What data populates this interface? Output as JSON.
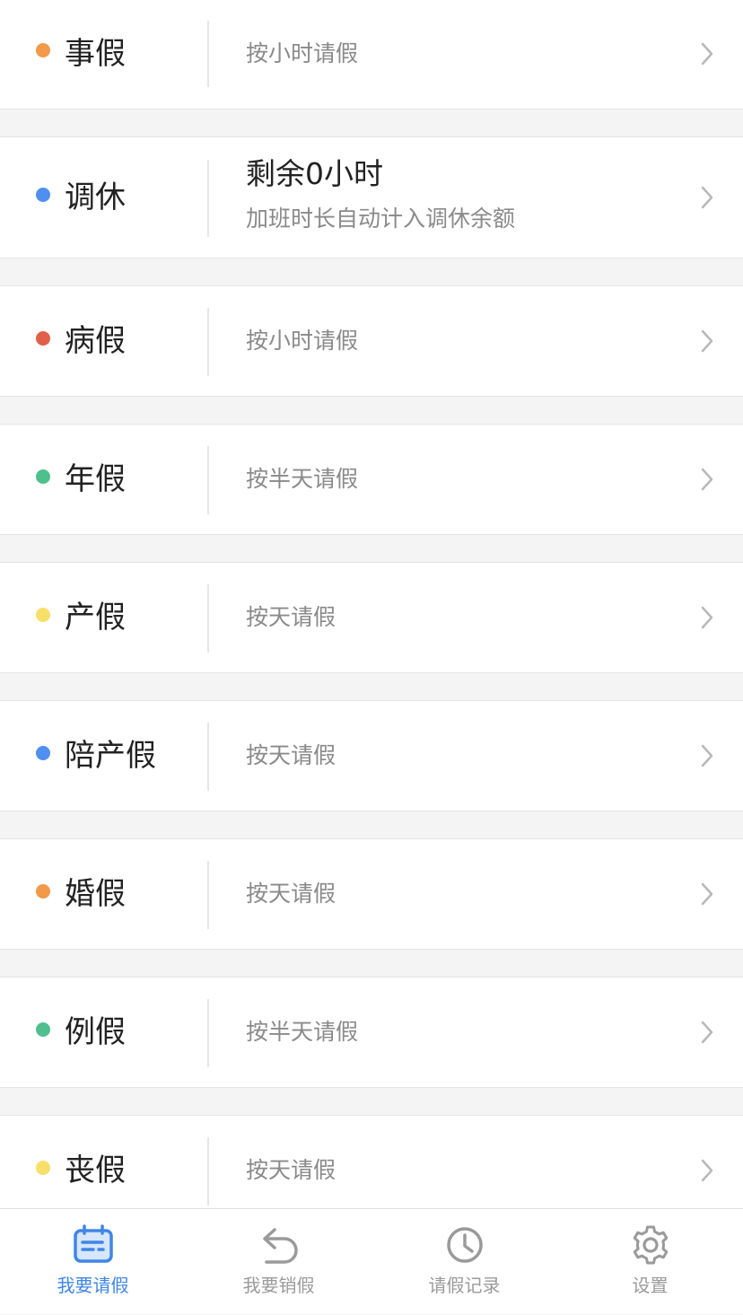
{
  "colors": {
    "orange": "#f2994a",
    "blue": "#4f8ff0",
    "red": "#e0604a",
    "green": "#4fc08d",
    "yellow": "#f7df6a",
    "active": "#3f86e6",
    "inactive": "#9a9a9a"
  },
  "leave_types": [
    {
      "name": "事假",
      "desc": "按小时请假",
      "dot": "orange"
    },
    {
      "name": "调休",
      "main": "剩余0小时",
      "desc": "加班时长自动计入调休余额",
      "dot": "blue"
    },
    {
      "name": "病假",
      "desc": "按小时请假",
      "dot": "red"
    },
    {
      "name": "年假",
      "desc": "按半天请假",
      "dot": "green"
    },
    {
      "name": "产假",
      "desc": "按天请假",
      "dot": "yellow"
    },
    {
      "name": "陪产假",
      "desc": "按天请假",
      "dot": "blue"
    },
    {
      "name": "婚假",
      "desc": "按天请假",
      "dot": "orange"
    },
    {
      "name": "例假",
      "desc": "按半天请假",
      "dot": "green"
    },
    {
      "name": "丧假",
      "desc": "按天请假",
      "dot": "yellow"
    }
  ],
  "tabbar": {
    "tabs": [
      {
        "label": "我要请假",
        "icon": "calendar-icon",
        "active": true
      },
      {
        "label": "我要销假",
        "icon": "undo-icon",
        "active": false
      },
      {
        "label": "请假记录",
        "icon": "clock-icon",
        "active": false
      },
      {
        "label": "设置",
        "icon": "gear-icon",
        "active": false
      }
    ]
  }
}
